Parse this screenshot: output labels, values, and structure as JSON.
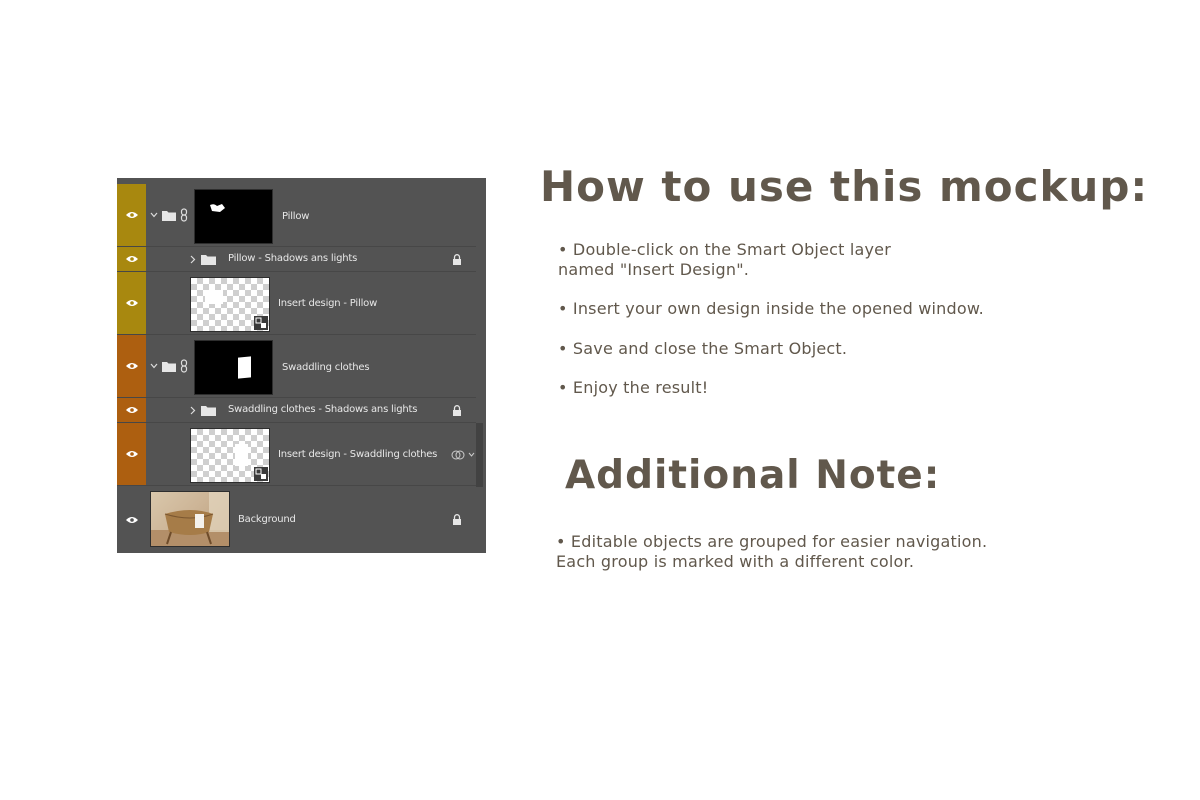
{
  "layers_panel": {
    "group_colors": {
      "pillow": "#a8880f",
      "swaddling": "#ad5f10"
    },
    "layers": [
      {
        "name": "Pillow",
        "type": "group",
        "expanded": true,
        "linked": true,
        "thumb": "black-mask"
      },
      {
        "name": "Pillow - Shadows ans lights",
        "type": "folder",
        "expanded": false,
        "locked": true
      },
      {
        "name": "Insert design - Pillow",
        "type": "smart-object",
        "thumb": "transparent"
      },
      {
        "name": "Swaddling clothes",
        "type": "group",
        "expanded": true,
        "linked": true,
        "thumb": "black-mask"
      },
      {
        "name": "Swaddling clothes - Shadows ans lights",
        "type": "folder",
        "expanded": false,
        "locked": true
      },
      {
        "name": "Insert design - Swaddling clothes",
        "type": "smart-object",
        "thumb": "transparent"
      },
      {
        "name": "Background",
        "type": "image",
        "locked": true,
        "thumb": "photo-basket"
      }
    ]
  },
  "instructions": {
    "title": "How to use this mockup:",
    "steps": [
      "• Double-click on the Smart Object layer",
      "named \"Insert Design\".",
      "• Insert your own design inside the opened window.",
      "• Save and close the Smart Object.",
      "• Enjoy the result!"
    ]
  },
  "note": {
    "title": "Additional Note:",
    "lines": [
      "• Editable objects are grouped for easier navigation.",
      "Each group is marked with a different color."
    ]
  },
  "colors": {
    "text": "#61584c",
    "panel": "#535353"
  }
}
